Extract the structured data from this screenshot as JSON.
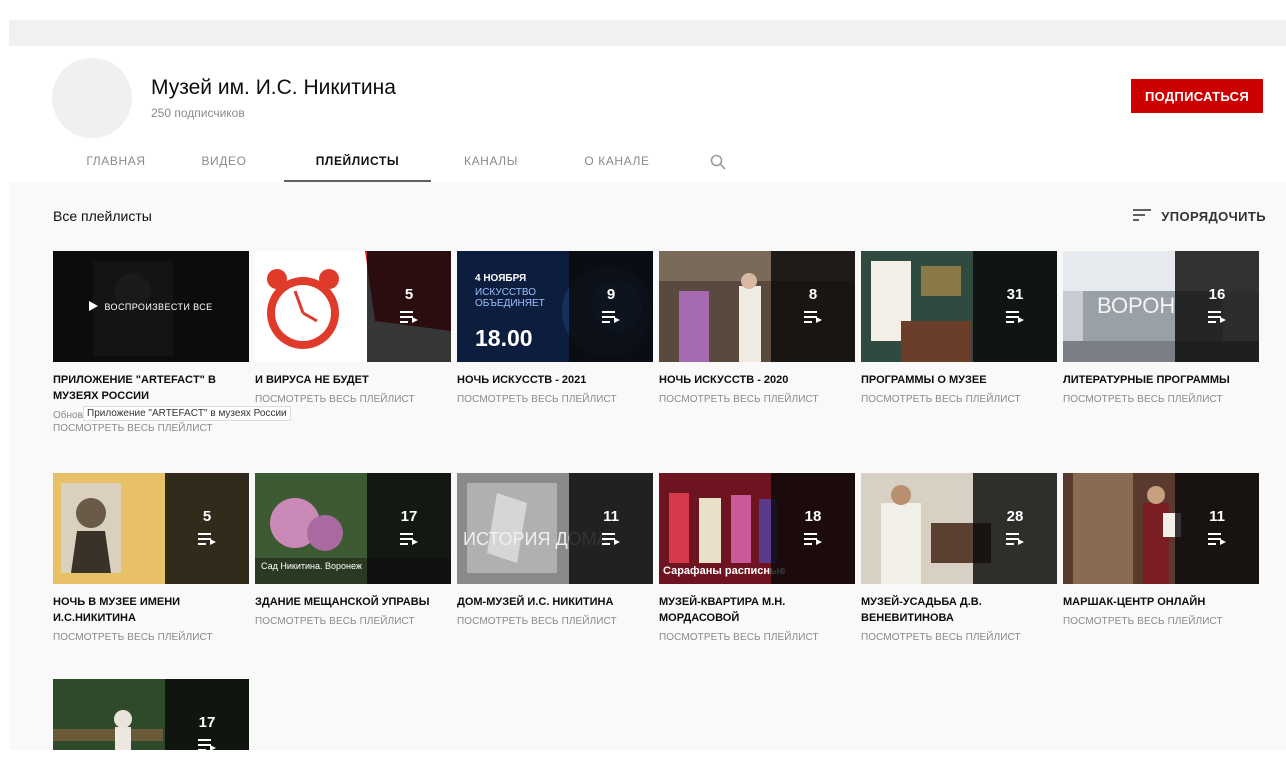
{
  "channel": {
    "name": "Музей им. И.С. Никитина",
    "subscribers": "250 подписчиков",
    "subscribe_label": "ПОДПИСАТЬСЯ"
  },
  "tabs": [
    {
      "label": "ГЛАВНАЯ"
    },
    {
      "label": "ВИДЕО"
    },
    {
      "label": "ПЛЕЙЛИСТЫ"
    },
    {
      "label": "КАНАЛЫ"
    },
    {
      "label": "О КАНАЛЕ"
    }
  ],
  "section": {
    "title": "Все плейлисты",
    "sort_label": "УПОРЯДОЧИТЬ"
  },
  "playlists": [
    {
      "title": "Приложение \"ARTEFACT\" в музеях России",
      "count": "",
      "link": "ПОСМОТРЕТЬ ВЕСЬ ПЛЕЙЛИСТ",
      "play_all": "ВОСПРОИЗВЕСТИ ВСЕ",
      "caption": "Обновле",
      "tooltip": "Приложение \"ARTEFACT\" в музеях России"
    },
    {
      "title": "И вируса не будет",
      "count": "5",
      "link": "ПОСМОТРЕТЬ ВЕСЬ ПЛЕЙЛИСТ"
    },
    {
      "title": "Ночь искусств - 2021",
      "count": "9",
      "link": "ПОСМОТРЕТЬ ВЕСЬ ПЛЕЙЛИСТ",
      "art_date": "4 НОЯБРЯ",
      "art_text": "ИСКУССТВО ОБЪЕДИНЯЕТ",
      "art_time": "18.00"
    },
    {
      "title": "Ночь искусств - 2020",
      "count": "8",
      "link": "ПОСМОТРЕТЬ ВЕСЬ ПЛЕЙЛИСТ"
    },
    {
      "title": "Программы о музее",
      "count": "31",
      "link": "ПОСМОТРЕТЬ ВЕСЬ ПЛЕЙЛИСТ"
    },
    {
      "title": "Литературные программы",
      "count": "16",
      "link": "ПОСМОТРЕТЬ ВЕСЬ ПЛЕЙЛИСТ",
      "art_text": "ВОРОН"
    },
    {
      "title": "Ночь в музее имени И.С.Никитина",
      "count": "5",
      "link": "ПОСМОТРЕТЬ ВЕСЬ ПЛЕЙЛИСТ"
    },
    {
      "title": "Здание мещанской управы",
      "count": "17",
      "link": "ПОСМОТРЕТЬ ВЕСЬ ПЛЕЙЛИСТ",
      "art_text": "Сад Никитина. Воронеж"
    },
    {
      "title": "Дом-музей И.С. Никитина",
      "count": "11",
      "link": "ПОСМОТРЕТЬ ВЕСЬ ПЛЕЙЛИСТ",
      "art_text": "ИСТОРИЯ ДОМА"
    },
    {
      "title": "Музей-квартира М.Н. Мордасовой",
      "count": "18",
      "link": "ПОСМОТРЕТЬ ВЕСЬ ПЛЕЙЛИСТ",
      "art_text": "Сарафаны расписные"
    },
    {
      "title": "Музей-усадьба Д.В. Веневитинова",
      "count": "28",
      "link": "ПОСМОТРЕТЬ ВЕСЬ ПЛЕЙЛИСТ"
    },
    {
      "title": "Маршак-центр онлайн",
      "count": "11",
      "link": "ПОСМОТРЕТЬ ВЕСЬ ПЛЕЙЛИСТ"
    },
    {
      "title": "",
      "count": "17",
      "link": ""
    }
  ],
  "colors": {
    "accent": "#cc0000",
    "text": "#0d0d0d",
    "muted": "#8a8a8a"
  },
  "icons": {
    "search": "search-icon",
    "sort": "sort-icon",
    "playlist": "playlist-icon",
    "play": "play-icon"
  }
}
